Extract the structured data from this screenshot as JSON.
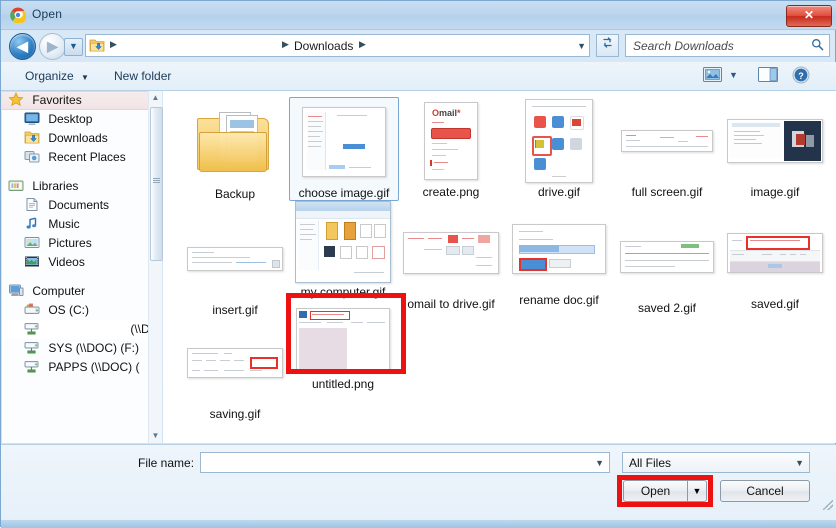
{
  "window": {
    "title": "Open",
    "title_icon": "chrome-logo-icon",
    "close_label": "✕"
  },
  "nav": {
    "back_icon": "back-arrow-icon",
    "forward_icon": "forward-arrow-icon",
    "recent_icon": "recent-locations-dropdown-icon",
    "address_folder_icon": "downloads-folder-icon",
    "breadcrumb": [
      "Downloads"
    ],
    "breadcrumb_separator": "▶",
    "address_dropdown_icon": "chevron-down-icon",
    "refresh_icon": "↯",
    "search": {
      "placeholder": "Search Downloads",
      "icon": "search-icon"
    }
  },
  "toolbar": {
    "organize_label": "Organize",
    "organize_caret": "▼",
    "new_folder_label": "New folder",
    "view_icon": "view-thumbnails-icon",
    "view_caret": "▼",
    "preview_icon": "preview-pane-icon",
    "help_icon": "help-icon",
    "help_glyph": "?"
  },
  "sidebar": {
    "groups": [
      {
        "name": "Favorites",
        "icon": "star-icon",
        "selected": true,
        "items": [
          {
            "label": "Desktop",
            "icon": "desktop-icon"
          },
          {
            "label": "Downloads",
            "icon": "downloads-folder-icon"
          },
          {
            "label": "Recent Places",
            "icon": "recent-places-icon"
          }
        ]
      },
      {
        "name": "Libraries",
        "icon": "libraries-icon",
        "selected": false,
        "items": [
          {
            "label": "Documents",
            "icon": "documents-icon"
          },
          {
            "label": "Music",
            "icon": "music-icon"
          },
          {
            "label": "Pictures",
            "icon": "pictures-icon"
          },
          {
            "label": "Videos",
            "icon": "videos-icon"
          }
        ]
      },
      {
        "name": "Computer",
        "icon": "computer-icon",
        "selected": false,
        "items": [
          {
            "label": "OS (C:)",
            "icon": "hard-drive-icon"
          },
          {
            "label": "(\\\\DO",
            "icon": "network-drive-icon",
            "truncated": true
          },
          {
            "label": "SYS (\\\\DOC) (F:)",
            "icon": "network-drive-icon"
          },
          {
            "label": "PAPPS (\\\\DOC) (",
            "icon": "network-drive-icon"
          }
        ]
      }
    ],
    "scrollbar": {
      "up_icon": "scroll-up-arrow-icon",
      "down_icon": "scroll-down-arrow-icon"
    }
  },
  "files": [
    {
      "name": "Backup",
      "type": "folder",
      "selected": false,
      "annotated": false
    },
    {
      "name": "choose image.gif",
      "type": "gif",
      "selected": true,
      "annotated": false
    },
    {
      "name": "create.png",
      "type": "png",
      "selected": false,
      "annotated": false
    },
    {
      "name": "drive.gif",
      "type": "gif",
      "selected": false,
      "annotated": false
    },
    {
      "name": "full screen.gif",
      "type": "gif",
      "selected": false,
      "annotated": false
    },
    {
      "name": "image.gif",
      "type": "gif",
      "selected": false,
      "annotated": false
    },
    {
      "name": "insert.gif",
      "type": "gif",
      "selected": false,
      "annotated": false
    },
    {
      "name": "my computer.gif",
      "type": "gif",
      "selected": false,
      "annotated": false
    },
    {
      "name": "omail to drive.gif",
      "type": "gif",
      "selected": false,
      "annotated": false
    },
    {
      "name": "rename doc.gif",
      "type": "gif",
      "selected": false,
      "annotated": false
    },
    {
      "name": "saved 2.gif",
      "type": "gif",
      "selected": false,
      "annotated": false
    },
    {
      "name": "saved.gif",
      "type": "gif",
      "selected": false,
      "annotated": false
    },
    {
      "name": "saving.gif",
      "type": "gif",
      "selected": false,
      "annotated": false
    },
    {
      "name": "untitled.png",
      "type": "png",
      "selected": false,
      "annotated": true
    }
  ],
  "thumbnail_text": {
    "create_brand": "Omail",
    "create_brand_mark": "O"
  },
  "footer": {
    "file_name_label": "File name:",
    "file_name_value": "",
    "file_name_caret": "▼",
    "filter_value": "All Files",
    "filter_caret": "▼",
    "open_label": "Open",
    "open_caret": "▼",
    "cancel_label": "Cancel"
  },
  "annotations": {
    "color": "#ee1111",
    "targets": [
      "untitled.png",
      "Open"
    ]
  }
}
